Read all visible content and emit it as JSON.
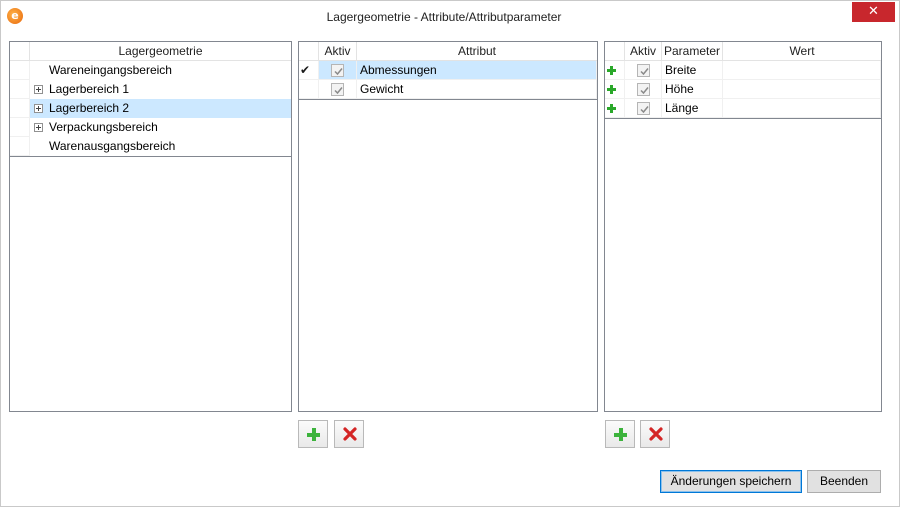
{
  "window": {
    "title": "Lagergeometrie - Attribute/Attributparameter",
    "close_glyph": "✕",
    "app_icon_glyph": "e"
  },
  "geometry_panel": {
    "header": "Lagergeometrie",
    "items": [
      {
        "label": "Wareneingangsbereich",
        "expandable": false,
        "selected": false
      },
      {
        "label": "Lagerbereich 1",
        "expandable": true,
        "selected": false
      },
      {
        "label": "Lagerbereich 2",
        "expandable": true,
        "selected": true
      },
      {
        "label": "Verpackungsbereich",
        "expandable": true,
        "selected": false
      },
      {
        "label": "Warenausgangsbereich",
        "expandable": false,
        "selected": false
      }
    ]
  },
  "attribute_panel": {
    "header_active": "Aktiv",
    "header_attribute": "Attribut",
    "current_row_marker": "✔",
    "rows": [
      {
        "attribute": "Abmessungen",
        "active": true,
        "selected": true
      },
      {
        "attribute": "Gewicht",
        "active": true,
        "selected": false
      }
    ]
  },
  "parameter_panel": {
    "header_active": "Aktiv",
    "header_parameter": "Parameter",
    "header_value": "Wert",
    "rows": [
      {
        "parameter": "Breite",
        "value": "",
        "active": true
      },
      {
        "parameter": "Höhe",
        "value": "",
        "active": true
      },
      {
        "parameter": "Länge",
        "value": "",
        "active": true
      }
    ]
  },
  "buttons": {
    "save_label": "Änderungen speichern",
    "close_label": "Beenden"
  },
  "colors": {
    "selection": "#cce8ff",
    "close_button": "#c8272d",
    "add_green": "#3cb33c",
    "delete_red": "#d42525"
  }
}
